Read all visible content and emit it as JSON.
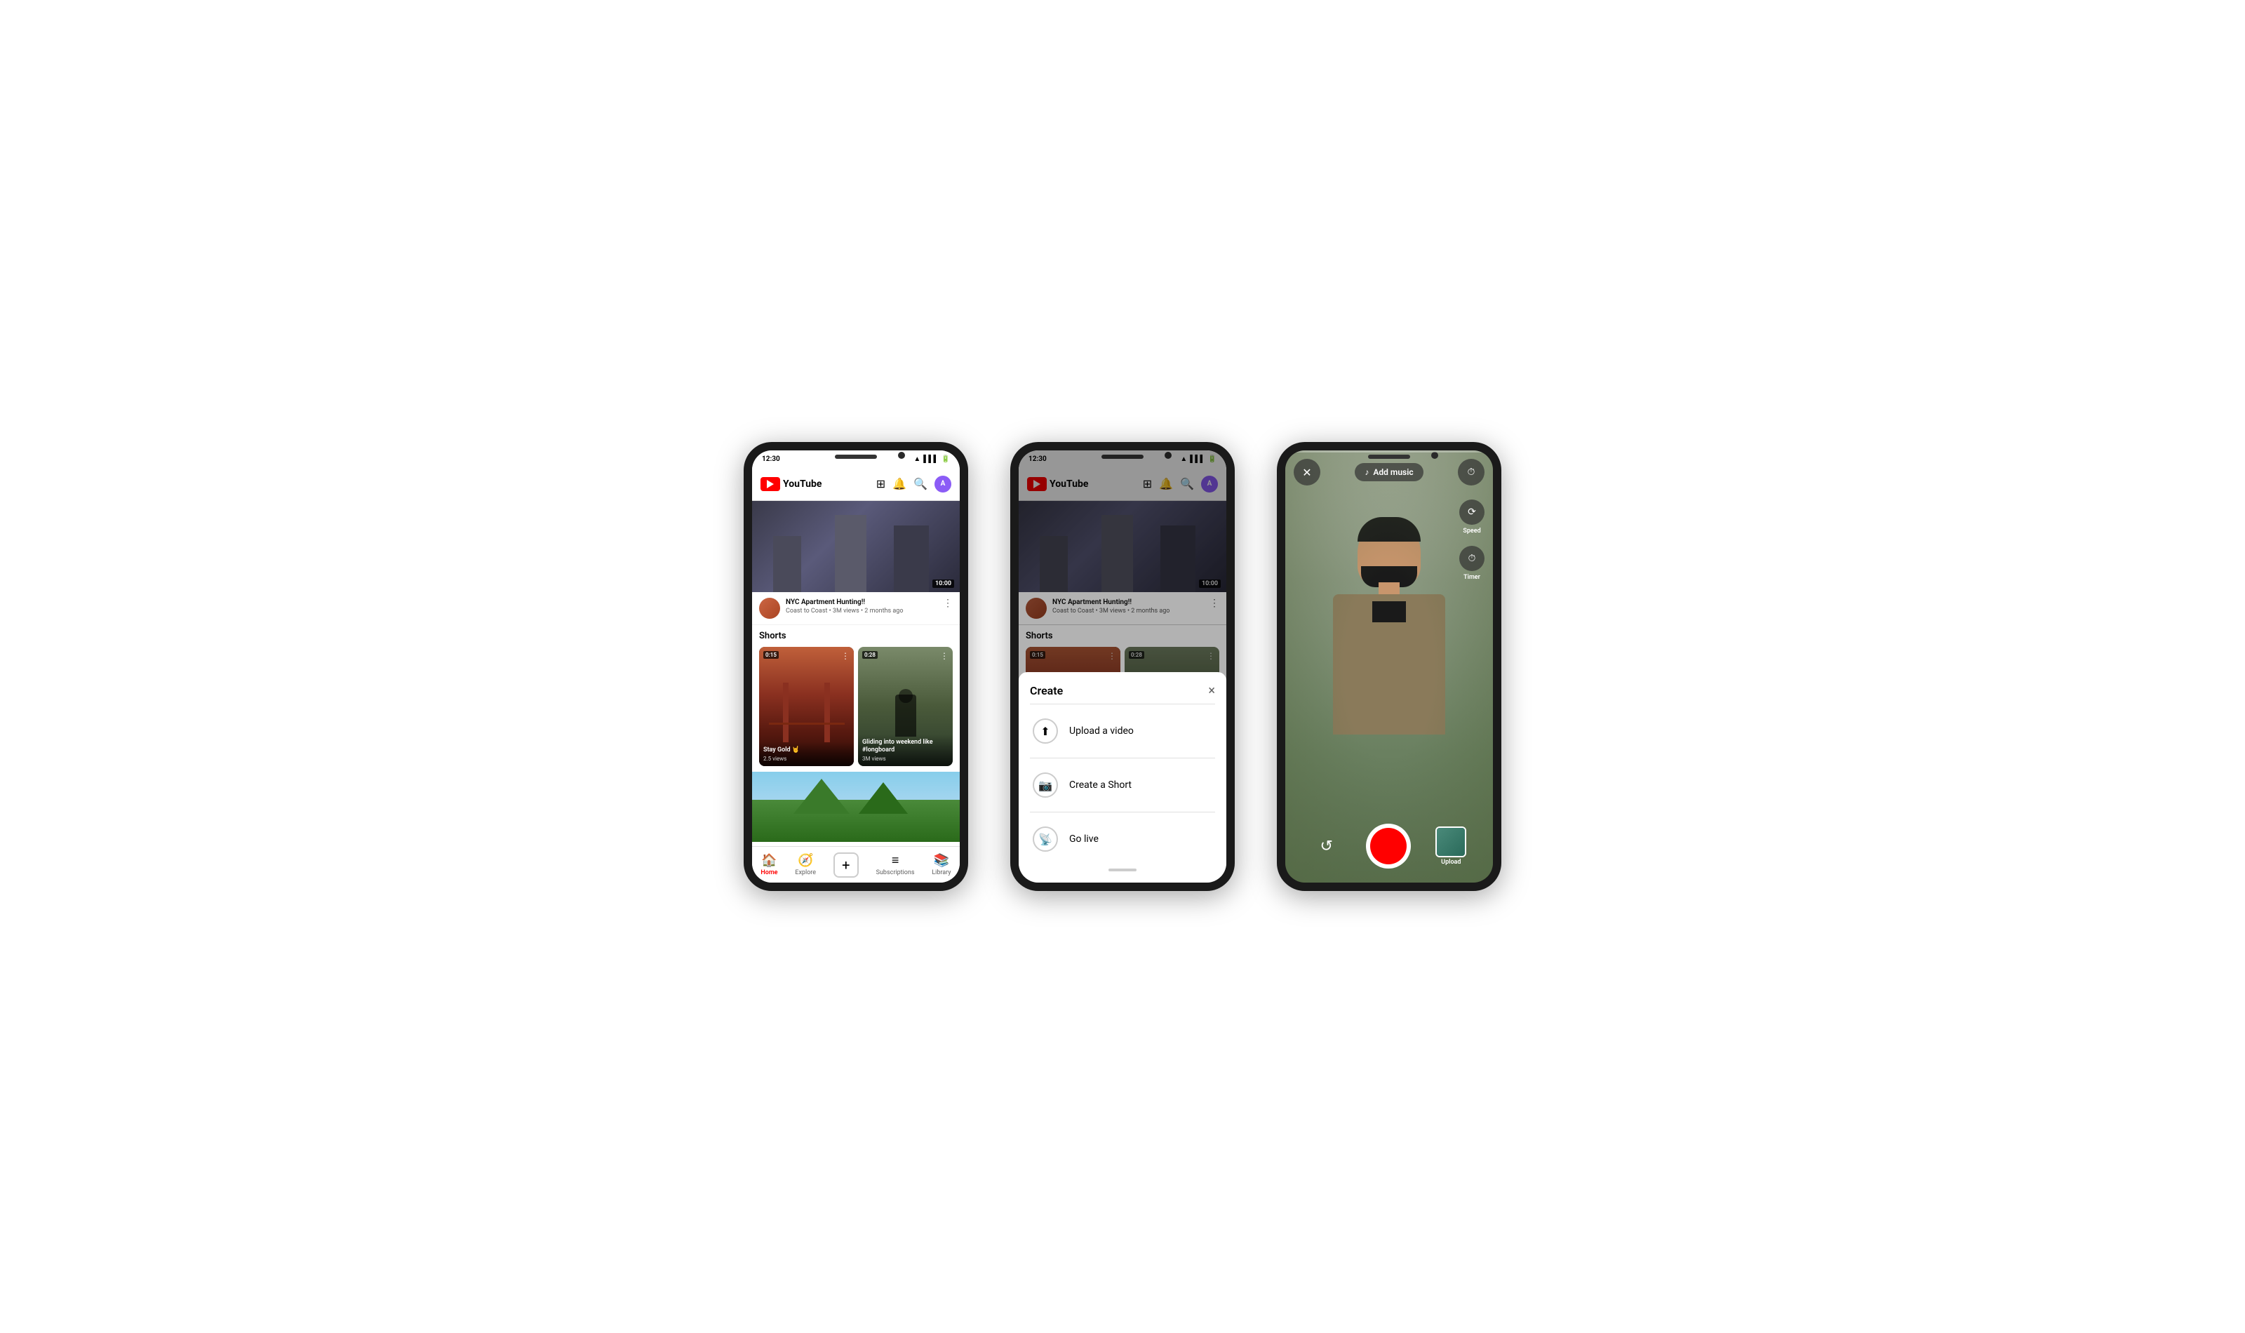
{
  "phones": [
    {
      "id": "phone1",
      "statusBar": {
        "time": "12:30",
        "icons": [
          "wifi",
          "signal",
          "battery"
        ]
      },
      "nav": {
        "logo": "YouTube",
        "icons": [
          "cast",
          "bell",
          "search",
          "avatar"
        ]
      },
      "video": {
        "duration": "10:00",
        "title": "NYC Apartment Hunting!!",
        "channel": "Coast to Coast",
        "meta": "3M views • 2 months ago"
      },
      "sections": {
        "shorts": {
          "header": "Shorts",
          "cards": [
            {
              "duration": "0:15",
              "title": "Stay Gold 🤘",
              "views": "2.5 views"
            },
            {
              "duration": "0:28",
              "title": "Gliding into weekend like #longboard",
              "views": "3M views"
            }
          ]
        }
      },
      "bottomNav": [
        {
          "icon": "🏠",
          "label": "Home",
          "active": true
        },
        {
          "icon": "🧭",
          "label": "Explore",
          "active": false
        },
        {
          "icon": "+",
          "label": "",
          "active": false,
          "isCreate": true
        },
        {
          "icon": "≡",
          "label": "Subscriptions",
          "active": false
        },
        {
          "icon": "📚",
          "label": "Library",
          "active": false
        }
      ]
    },
    {
      "id": "phone2",
      "statusBar": {
        "time": "12:30"
      },
      "modal": {
        "title": "Create",
        "closeLabel": "×",
        "items": [
          {
            "icon": "⬆",
            "label": "Upload a video"
          },
          {
            "icon": "📷",
            "label": "Create a Short"
          },
          {
            "icon": "📡",
            "label": "Go live"
          }
        ]
      }
    },
    {
      "id": "phone3",
      "camera": {
        "addMusicLabel": "Add music",
        "speedLabel": "Speed",
        "timerLabel": "Timer",
        "uploadLabel": "Upload",
        "flipIcon": "↺"
      }
    }
  ]
}
